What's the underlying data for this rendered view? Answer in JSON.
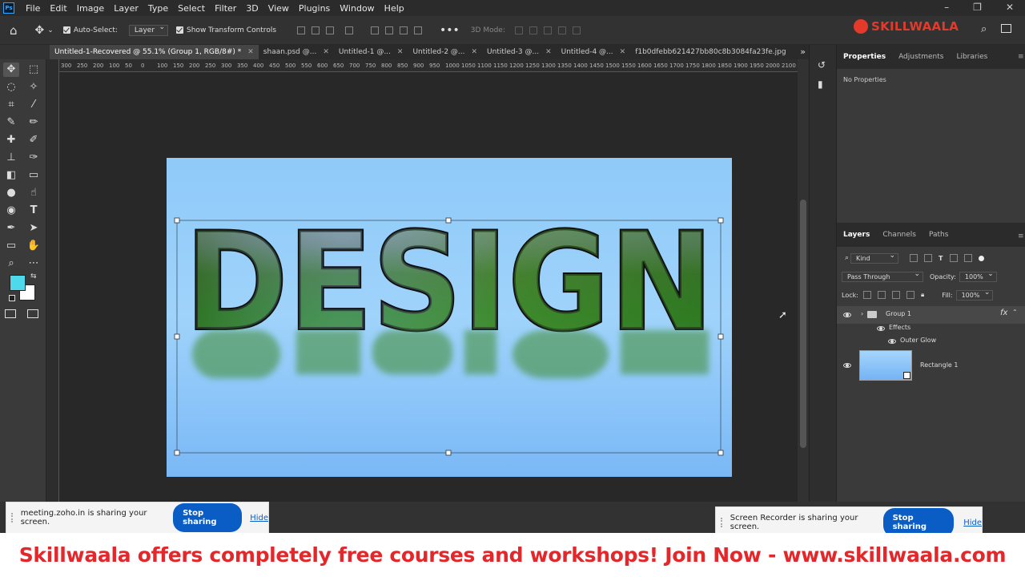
{
  "app": {
    "logo": "Ps"
  },
  "menu": [
    "File",
    "Edit",
    "Image",
    "Layer",
    "Type",
    "Select",
    "Filter",
    "3D",
    "View",
    "Plugins",
    "Window",
    "Help"
  ],
  "options_bar": {
    "auto_select_label": "Auto-Select:",
    "auto_select_value": "Layer",
    "show_transform_label": "Show Transform Controls",
    "mode_3d_label": "3D Mode:"
  },
  "brand": {
    "name": "SKILLWAALA"
  },
  "tabs": [
    {
      "label": "Untitled-1-Recovered @ 55.1% (Group 1, RGB/8#) *",
      "active": true
    },
    {
      "label": "shaan.psd @...",
      "active": false
    },
    {
      "label": "Untitled-1 @...",
      "active": false
    },
    {
      "label": "Untitled-2 @...",
      "active": false
    },
    {
      "label": "Untitled-3 @...",
      "active": false
    },
    {
      "label": "Untitled-4 @...",
      "active": false
    },
    {
      "label": "f1b0dfebb621427bb80c8b3084fa23fe.jpg",
      "active": false
    }
  ],
  "ruler_ticks": [
    "300",
    "250",
    "200",
    "100",
    "50",
    "0",
    "100",
    "150",
    "200",
    "250",
    "300",
    "350",
    "400",
    "450",
    "500",
    "550",
    "600",
    "650",
    "700",
    "750",
    "800",
    "850",
    "900",
    "950",
    "1000",
    "1050",
    "1100",
    "1150",
    "1200",
    "1250",
    "1300",
    "1350",
    "1400",
    "1450",
    "1500",
    "1550",
    "1600",
    "1650",
    "1700",
    "1750",
    "1800",
    "1850",
    "1900",
    "1950",
    "2000",
    "2100"
  ],
  "canvas": {
    "text": "DESIGN",
    "colors": {
      "sky_top": "#8fcaf9",
      "sky_bottom": "#7ab8f6",
      "fg_swatch": "#4fd9ec",
      "bg_swatch": "#ffffff"
    }
  },
  "properties_panel": {
    "tabs": [
      "Properties",
      "Adjustments",
      "Libraries"
    ],
    "content": "No Properties"
  },
  "layers_panel": {
    "tabs": [
      "Layers",
      "Channels",
      "Paths"
    ],
    "filter_label": "Kind",
    "blend_mode": "Pass Through",
    "opacity_label": "Opacity:",
    "opacity_value": "100%",
    "lock_label": "Lock:",
    "fill_label": "Fill:",
    "fill_value": "100%",
    "layers": [
      {
        "name": "Group 1",
        "fx": "fx"
      },
      {
        "name": "Effects"
      },
      {
        "name": "Outer Glow"
      },
      {
        "name": "Rectangle 1"
      }
    ]
  },
  "share_left": {
    "message": "meeting.zoho.in is sharing your screen.",
    "stop": "Stop sharing",
    "hide": "Hide"
  },
  "share_right": {
    "message": "Screen Recorder is sharing your screen.",
    "stop": "Stop sharing",
    "hide": "Hide"
  },
  "banner": {
    "text": "Skillwaala offers completely free courses and workshops! Join Now  - www.skillwaala.com"
  }
}
